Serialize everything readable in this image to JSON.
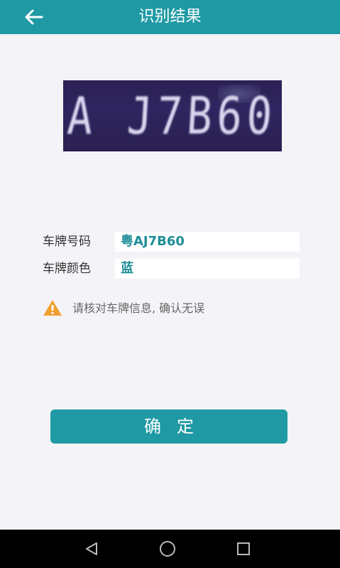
{
  "header": {
    "title": "识别结果",
    "back_icon": "arrow-left-icon"
  },
  "plate_image": {
    "text": "A J7B60"
  },
  "fields": {
    "plate_number": {
      "label": "车牌号码",
      "value": "粤AJ7B60"
    },
    "plate_color": {
      "label": "车牌颜色",
      "value": "蓝"
    }
  },
  "warning": {
    "icon": "warning-triangle-icon",
    "text": "请核对车牌信息, 确认无误"
  },
  "confirm_button": {
    "label": "确定"
  },
  "navbar": {
    "back_icon": "nav-back-icon",
    "home_icon": "nav-home-icon",
    "recents_icon": "nav-recents-icon"
  },
  "colors": {
    "accent": "#1f9aa4",
    "value_text": "#1f8e97",
    "warning": "#f0a030"
  }
}
